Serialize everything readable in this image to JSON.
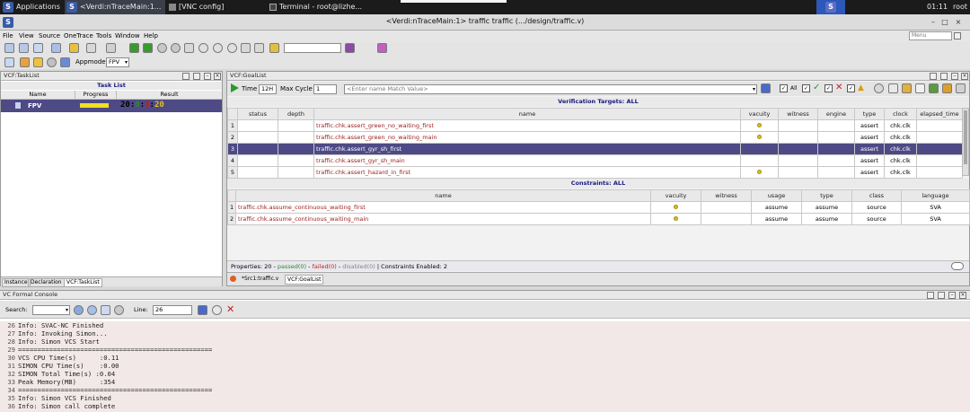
{
  "system_bar": {
    "applications": "Applications",
    "tasks": [
      {
        "label": "<Verdi:nTraceMain:1..."
      },
      {
        "label": "[VNC config]"
      },
      {
        "label": "Terminal - root@lizhe..."
      }
    ],
    "clock": "01:11",
    "user": "root"
  },
  "window": {
    "title": "<Verdi:nTraceMain:1> traffic traffic (.../design/traffic.v)"
  },
  "menu": {
    "items": [
      "File",
      "View",
      "Source",
      "OneTrace",
      "Tools",
      "Window",
      "Help"
    ],
    "search_placeholder": "Menu"
  },
  "toolbar2": {
    "appmode_label": "Appmode:",
    "appmode_value": "FPV"
  },
  "task_panel": {
    "title": "VCF:TaskList",
    "list_title": "Task List",
    "columns": [
      "Name",
      "Progress",
      "Result"
    ],
    "row": {
      "name": "FPV",
      "result_text": "20:",
      "result_a": "0",
      "result_b": "0",
      "result_c": "20"
    },
    "progress": 1.0,
    "tabs": [
      "Instance",
      "Declaration",
      "VCF:TaskList"
    ]
  },
  "goal_panel": {
    "title": "VCF:GoalList",
    "time_label": "Time",
    "time_value": "12H",
    "maxcycle_label": "Max Cycle",
    "maxcycle_value": "1",
    "filter_placeholder": "<Enter name Match Value>",
    "all_label": "All",
    "targets_title": "Verification Targets: ALL",
    "target_columns": [
      "status",
      "depth",
      "name",
      "vacuity",
      "witness",
      "engine",
      "type",
      "clock",
      "elapsed_time"
    ],
    "targets": [
      {
        "n": "1",
        "name": "traffic.chk.assert_green_no_waiting_first",
        "vacuity": true,
        "type": "assert",
        "clock": "chk.clk"
      },
      {
        "n": "2",
        "name": "traffic.chk.assert_green_no_waiting_main",
        "vacuity": true,
        "type": "assert",
        "clock": "chk.clk"
      },
      {
        "n": "3",
        "name": "traffic.chk.assert_gyr_sh_first",
        "vacuity": false,
        "type": "assert",
        "clock": "chk.clk"
      },
      {
        "n": "4",
        "name": "traffic.chk.assert_gyr_sh_main",
        "vacuity": false,
        "type": "assert",
        "clock": "chk.clk"
      },
      {
        "n": "5",
        "name": "traffic.chk.assert_hazard_in_first",
        "vacuity": true,
        "type": "assert",
        "clock": "chk.clk"
      }
    ],
    "constraints_title": "Constraints: ALL",
    "constraint_columns": [
      "name",
      "vacuity",
      "witness",
      "usage",
      "type",
      "class",
      "language"
    ],
    "constraints": [
      {
        "n": "1",
        "name": "traffic.chk.assume_continuous_waiting_first",
        "usage": "assume",
        "type": "assume",
        "class": "source",
        "language": "SVA"
      },
      {
        "n": "2",
        "name": "traffic.chk.assume_continuous_waiting_main",
        "usage": "assume",
        "type": "assume",
        "class": "source",
        "language": "SVA"
      }
    ],
    "status": {
      "prefix": "Properties: 20 - ",
      "passed": "passed(0)",
      "sep1": " - ",
      "failed": "failed(0)",
      "sep2": " - ",
      "disabled": "disabled(0)",
      "suffix": " | Constraints Enabled: 2"
    },
    "tabs": [
      "*Src1:traffic.v",
      "VCF:GoalList"
    ]
  },
  "console": {
    "title": "VC Formal Console",
    "search_label": "Search:",
    "line_label": "Line:",
    "line_value": "26",
    "lines": [
      {
        "n": "26",
        "t": "Info: SVAC-NC Finished"
      },
      {
        "n": "27",
        "t": "Info: Invoking Simon..."
      },
      {
        "n": "28",
        "t": "Info: Simon VCS Start"
      },
      {
        "n": "29",
        "t": "=================================================="
      },
      {
        "n": "30",
        "t": "VCS CPU Time(s)      :0.11"
      },
      {
        "n": "31",
        "t": "SIMON CPU Time(s)    :0.00"
      },
      {
        "n": "32",
        "t": "SIMON Total Time(s) :0.04"
      },
      {
        "n": "33",
        "t": "Peak Memory(MB)      :354"
      },
      {
        "n": "34",
        "t": "=================================================="
      },
      {
        "n": "35",
        "t": "Info: Simon VCS Finished"
      },
      {
        "n": "36",
        "t": "Info: Simon call complete"
      }
    ]
  }
}
